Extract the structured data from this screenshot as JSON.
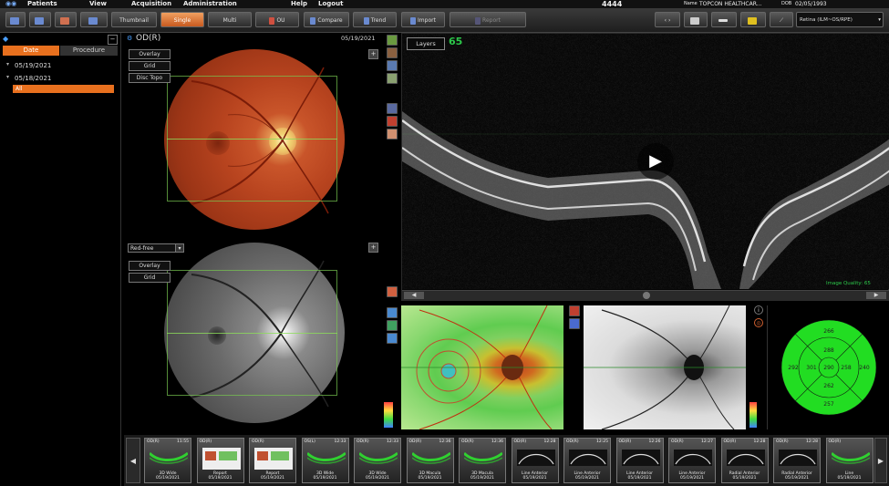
{
  "menubar": {
    "items": [
      "Patients",
      "View",
      "Acquisition",
      "Administration",
      "Help",
      "Logout"
    ],
    "patient_id": "4444",
    "name_label": "Name",
    "name_value": "TOPCON HEALTHCAR...",
    "dob_label": "DOB",
    "dob_value": "02/05/1993"
  },
  "toolbar": {
    "buttons": [
      "Thumbnail",
      "Single",
      "Multi",
      "OU",
      "Compare",
      "Trend",
      "Import",
      "Report"
    ],
    "layer_select": "Retina (ILM~OS/RPE)"
  },
  "left_panel": {
    "tabs": [
      "Date",
      "Procedure"
    ],
    "exams": [
      "05/19/2021",
      "05/18/2021"
    ],
    "selected_item": "All"
  },
  "fundus": {
    "eye_label": "OD(R)",
    "date": "05/19/2021",
    "top_buttons": [
      "Overlay",
      "Grid",
      "Disc Topo"
    ],
    "filter_select": "Red-free",
    "bottom_buttons": [
      "Overlay",
      "Grid"
    ]
  },
  "oct": {
    "layers_button": "Layers",
    "score": "65",
    "image_quality": "Image Quality: 65"
  },
  "etdrs": {
    "sectors": [
      "266",
      "288",
      "292",
      "301",
      "290",
      "258",
      "240",
      "262",
      "257"
    ]
  },
  "thumbnails": [
    {
      "eye": "OD(R)",
      "time": "11:55",
      "caption": "3D Wide",
      "date": "05/19/2021"
    },
    {
      "eye": "OD(R)",
      "time": "",
      "caption": "Report",
      "date": "05/19/2021"
    },
    {
      "eye": "OD(R)",
      "time": "",
      "caption": "Report",
      "date": "05/19/2021"
    },
    {
      "eye": "OS(L)",
      "time": "12:33",
      "caption": "3D Wide",
      "date": "05/19/2021"
    },
    {
      "eye": "OD(R)",
      "time": "12:33",
      "caption": "3D Wide",
      "date": "05/19/2021"
    },
    {
      "eye": "OD(R)",
      "time": "12:36",
      "caption": "3D Macula",
      "date": "05/19/2021"
    },
    {
      "eye": "OD(R)",
      "time": "12:36",
      "caption": "3D Macula",
      "date": "05/19/2021"
    },
    {
      "eye": "OD(R)",
      "time": "12:28",
      "caption": "Line Anterior",
      "date": "05/19/2021"
    },
    {
      "eye": "OD(R)",
      "time": "12:25",
      "caption": "Line Anterior",
      "date": "05/19/2021"
    },
    {
      "eye": "OD(R)",
      "time": "12:26",
      "caption": "Line Anterior",
      "date": "05/19/2021"
    },
    {
      "eye": "OD(R)",
      "time": "12:27",
      "caption": "Line Anterior",
      "date": "05/19/2021"
    },
    {
      "eye": "OD(R)",
      "time": "12:28",
      "caption": "Radial Anterior",
      "date": "05/19/2021"
    },
    {
      "eye": "OD(R)",
      "time": "12:28",
      "caption": "Radial Anterior",
      "date": "05/19/2021"
    },
    {
      "eye": "OD(R)",
      "time": "",
      "caption": "Line",
      "date": "05/19/2021"
    }
  ],
  "colors": {
    "accent_orange": "#e8701e",
    "map_green": "#22dd22",
    "guide_green": "#78c850"
  }
}
